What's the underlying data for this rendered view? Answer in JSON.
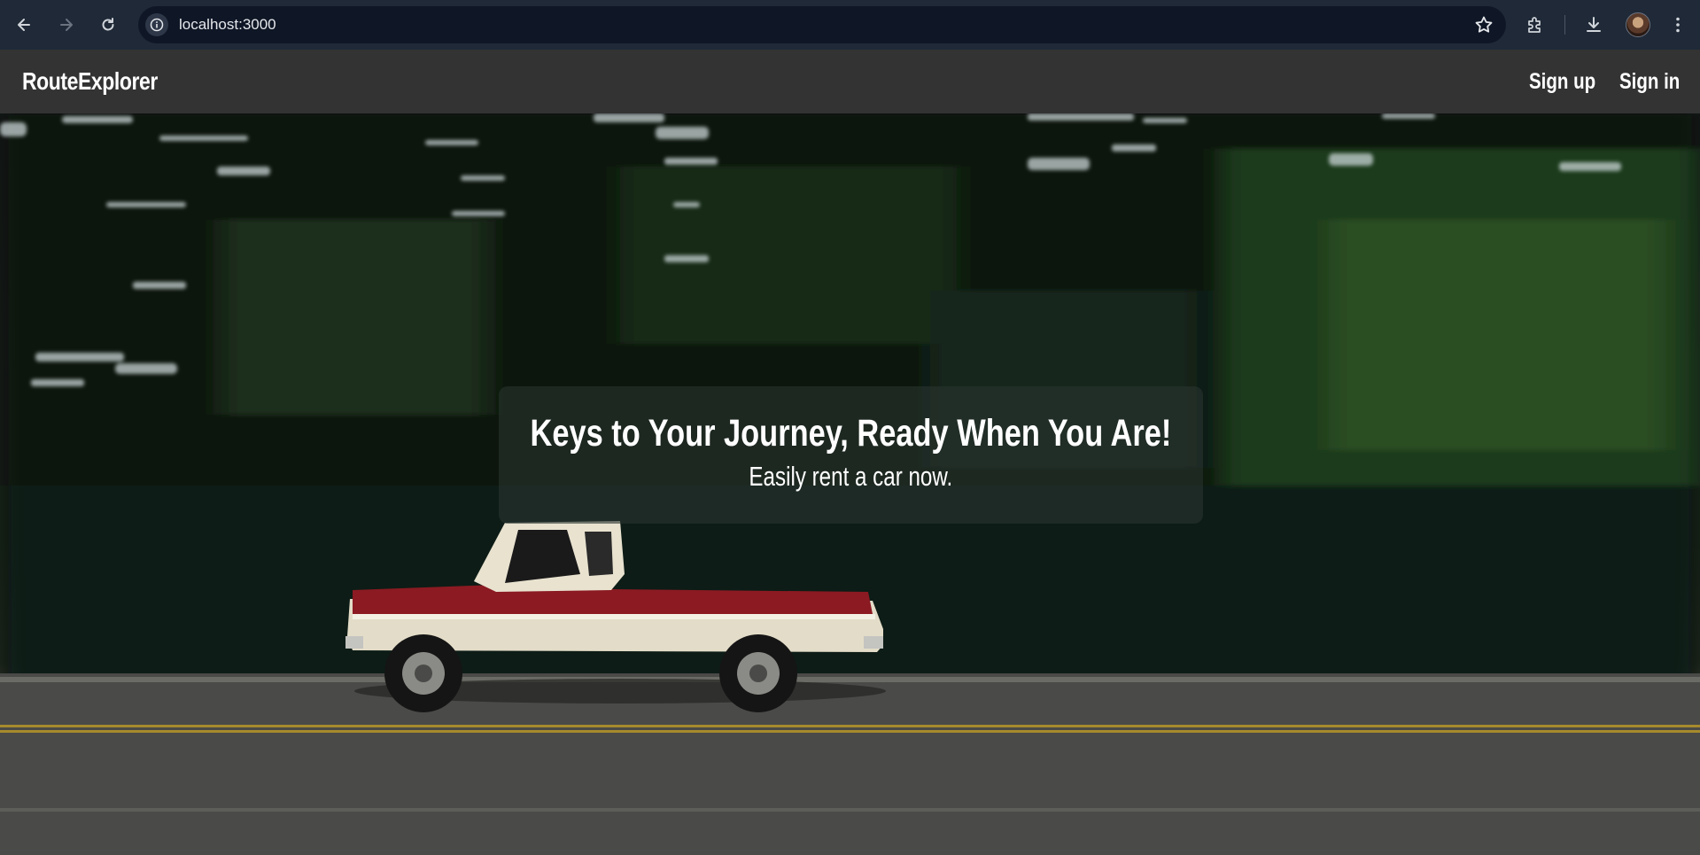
{
  "browser": {
    "url": "localhost:3000"
  },
  "navbar": {
    "brand": "RouteExplorer",
    "links": [
      "Sign up",
      "Sign in"
    ]
  },
  "hero": {
    "title": "Keys to Your Journey, Ready When You Are!",
    "subtitle": "Easily rent a car now."
  },
  "icons": [
    "back-icon",
    "forward-icon",
    "reload-icon",
    "info-icon",
    "star-icon",
    "extensions-icon",
    "download-icon",
    "menu-icon"
  ],
  "colors": {
    "browser_bar": "#1f2937",
    "navbar": "#333333",
    "truck_red": "#8b1a22",
    "truck_cream": "#e8e2cf"
  }
}
